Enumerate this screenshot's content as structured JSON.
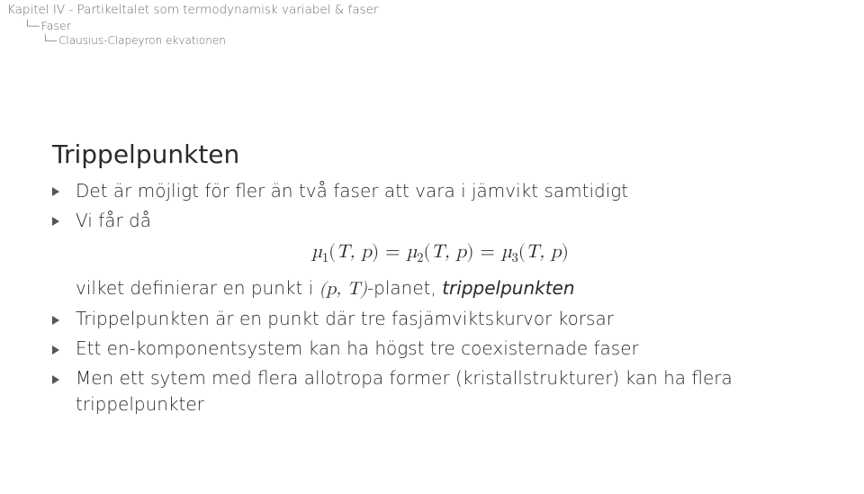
{
  "breadcrumb": {
    "line1": "Kapitel IV - Partikeltalet som termodynamisk variabel & faser",
    "line2": "Faser",
    "line3": "Clausius-Clapeyron ekvationen"
  },
  "slide": {
    "title": "Trippelpunkten",
    "bullets": {
      "b1": "Det är möjligt för fler än två faser att vara i jämvikt samtidigt",
      "b2_lead": "Vi får då",
      "b2_cont_pre": "vilket definierar en punkt i ",
      "b2_cont_math": "(p, T)",
      "b2_cont_mid": "-planet, ",
      "b2_cont_term": "trippelpunkten",
      "b3": "Trippelpunkten är en punkt där tre fasjämviktskurvor korsar",
      "b4": "Ett en-komponentsystem kan ha högst tre coexisternade faser",
      "b5": "Men ett sytem med flera allotropa former (kristallstrukturer) kan ha flera trippelpunkter"
    },
    "equation": "μ₁(T, p) = μ₂(T, p) = μ₃(T, p)"
  },
  "chart_data": {
    "type": "none"
  }
}
